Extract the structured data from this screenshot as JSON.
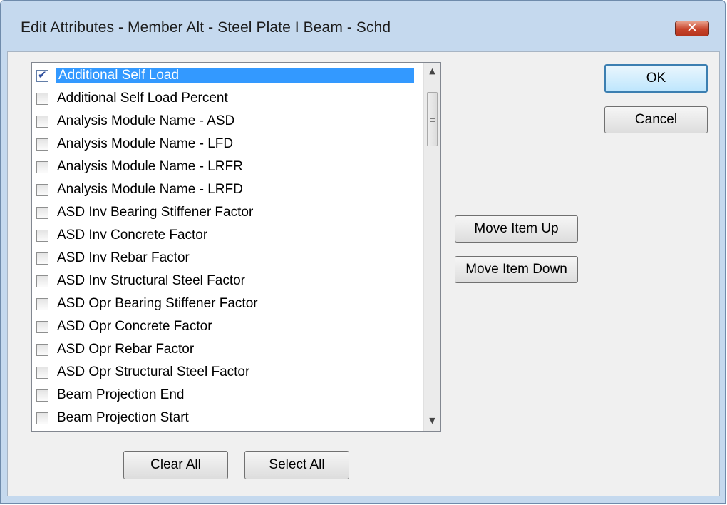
{
  "window": {
    "title": "Edit Attributes - Member Alt - Steel Plate I Beam - Schd"
  },
  "list": {
    "items": [
      {
        "label": "Additional Self Load",
        "checked": true,
        "selected": true
      },
      {
        "label": "Additional Self Load Percent",
        "checked": false
      },
      {
        "label": "Analysis Module Name - ASD",
        "checked": false
      },
      {
        "label": "Analysis Module Name - LFD",
        "checked": false
      },
      {
        "label": "Analysis Module Name - LRFR",
        "checked": false
      },
      {
        "label": "Analysis Module Name - LRFD",
        "checked": false
      },
      {
        "label": "ASD Inv Bearing Stiffener Factor",
        "checked": false
      },
      {
        "label": "ASD Inv Concrete Factor",
        "checked": false
      },
      {
        "label": "ASD Inv Rebar Factor",
        "checked": false
      },
      {
        "label": "ASD Inv Structural Steel Factor",
        "checked": false
      },
      {
        "label": "ASD Opr Bearing Stiffener Factor",
        "checked": false
      },
      {
        "label": "ASD Opr Concrete Factor",
        "checked": false
      },
      {
        "label": "ASD Opr Rebar Factor",
        "checked": false
      },
      {
        "label": "ASD Opr Structural Steel Factor",
        "checked": false
      },
      {
        "label": "Beam Projection End",
        "checked": false
      },
      {
        "label": "Beam Projection Start",
        "checked": false
      }
    ]
  },
  "buttons": {
    "ok": "OK",
    "cancel": "Cancel",
    "move_up": "Move Item Up",
    "move_down": "Move Item Down",
    "clear_all": "Clear All",
    "select_all": "Select All"
  },
  "icons": {
    "close": "close-icon",
    "scroll_up": "scroll-up-arrow-icon",
    "scroll_down": "scroll-down-arrow-icon"
  },
  "colors": {
    "selection": "#3399ff",
    "close_button": "#c7442b",
    "frame": "#c5d9ee"
  }
}
